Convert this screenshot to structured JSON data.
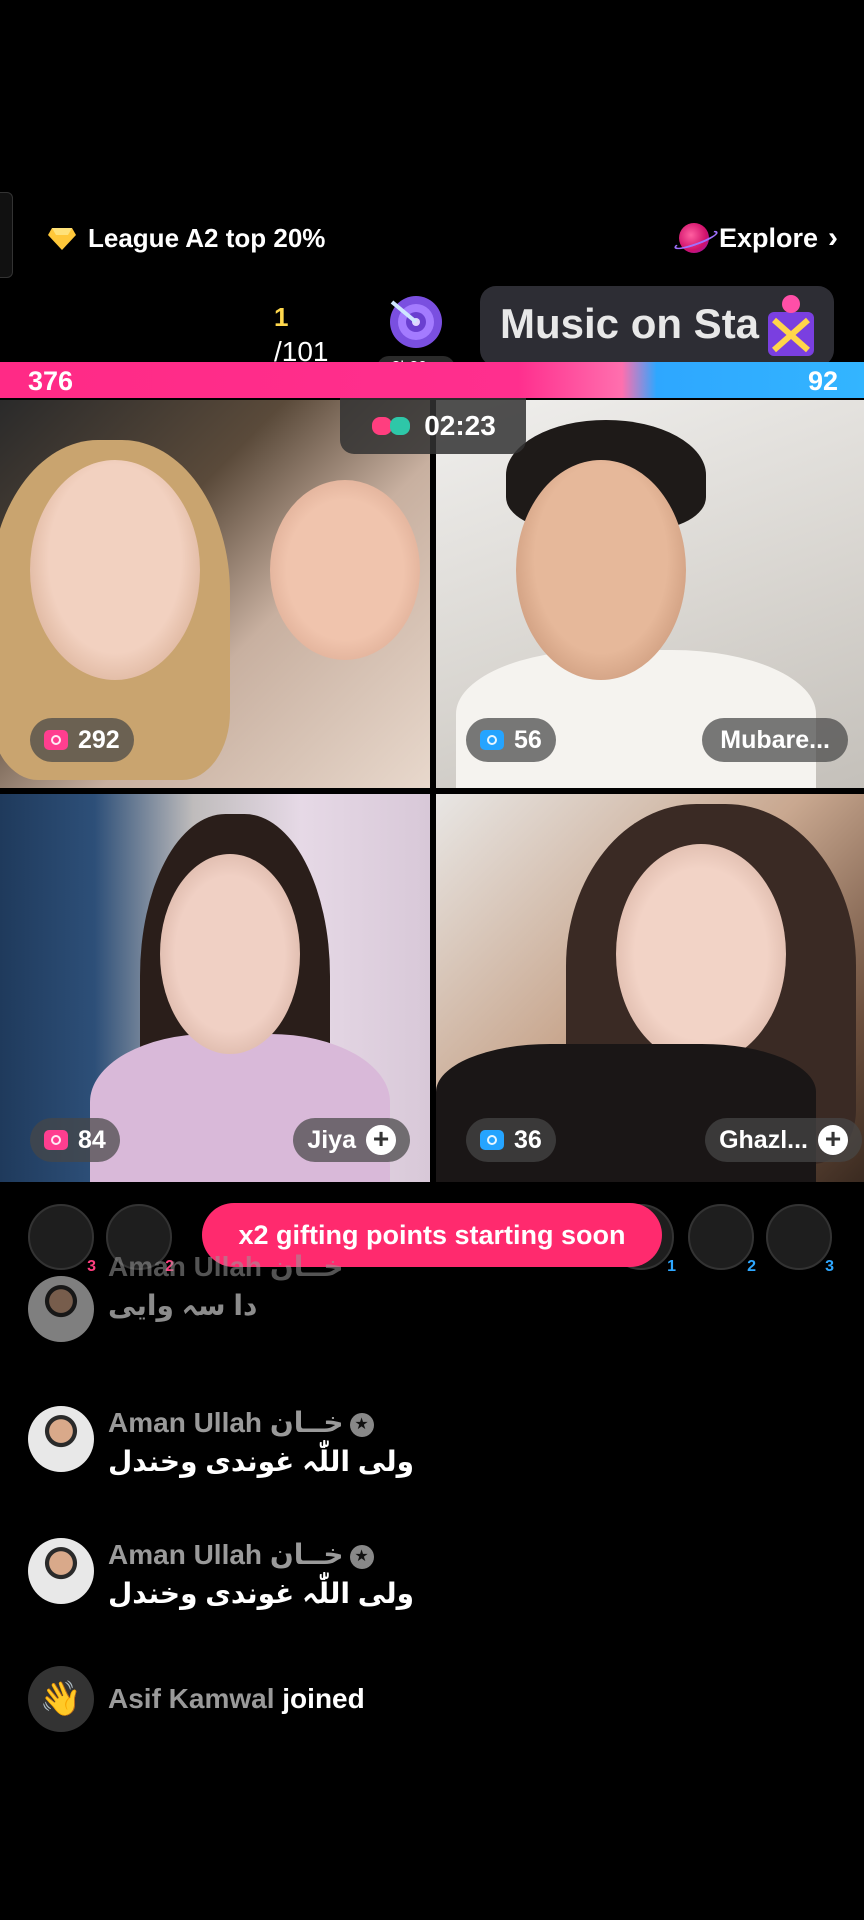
{
  "header": {
    "league_text": "League A2 top 20%",
    "explore_label": "Explore",
    "rank_current": "1",
    "rank_total": "/101",
    "event_timer": "2h29m",
    "music_banner": "Music on Sta"
  },
  "battle": {
    "score_left": "376",
    "score_right": "92",
    "timer": "02:23",
    "progress_left_fraction": 0.8
  },
  "tiles": [
    {
      "views": "292",
      "name": ""
    },
    {
      "views": "56",
      "name": "Mubare..."
    },
    {
      "views": "84",
      "name": "Jiya"
    },
    {
      "views": "36",
      "name": "Ghazl..."
    }
  ],
  "viewer_row": {
    "banner": "x2 gifting points starting soon",
    "counts": [
      "3",
      "2",
      "1",
      "2",
      "3"
    ]
  },
  "chat": [
    {
      "name": "Aman Ullah خــان",
      "text": "دا سہ وایی"
    },
    {
      "name": "Aman Ullah خــان",
      "text": "ولی اللّٰہ غوندی وخندل"
    },
    {
      "name": "Aman Ullah خــان",
      "text": "ولی اللّٰہ غوندی وخندل"
    },
    {
      "name": "Asif Kamwal",
      "text": "joined"
    }
  ],
  "colors": {
    "accent_pink": "#ff2a86",
    "accent_blue": "#2ea7ff",
    "banner": "#ff2a6e"
  }
}
